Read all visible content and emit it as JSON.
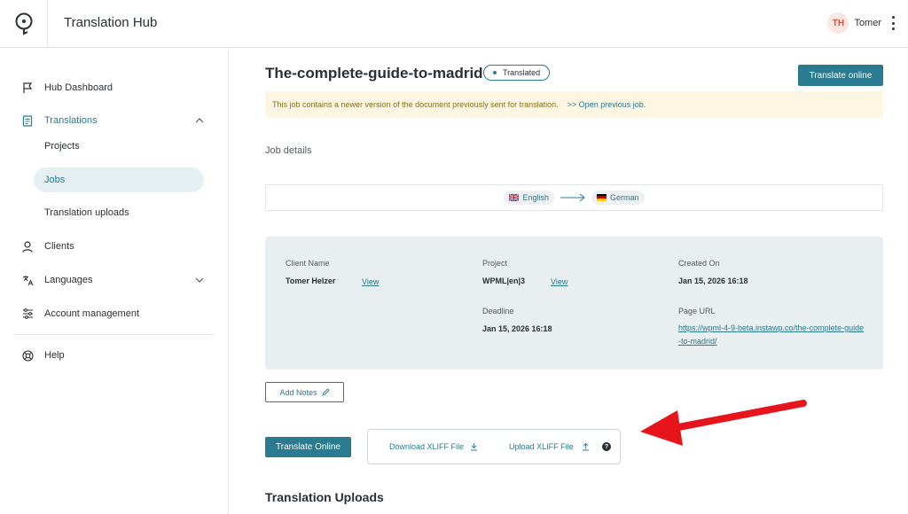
{
  "header": {
    "app_title": "Translation Hub",
    "user_initials": "TH",
    "user_name": "Tomer"
  },
  "sidebar": {
    "items": [
      {
        "label": "Hub Dashboard",
        "icon": "flag-icon"
      },
      {
        "label": "Translations",
        "icon": "document-icon"
      },
      {
        "label": "Projects"
      },
      {
        "label": "Jobs"
      },
      {
        "label": "Translation uploads"
      },
      {
        "label": "Clients",
        "icon": "person-icon"
      },
      {
        "label": "Languages",
        "icon": "translate-icon"
      },
      {
        "label": "Account management",
        "icon": "sliders-icon"
      },
      {
        "label": "Help",
        "icon": "lifebuoy-icon"
      }
    ]
  },
  "job": {
    "title": "The-complete-guide-to-madrid",
    "status": "Translated",
    "translate_online_top": "Translate online",
    "notice_text": "This job contains a newer version of the document previously sent for translation.",
    "notice_link": ">> Open previous job.",
    "section_label": "Job details",
    "source_lang": "English",
    "target_lang": "German",
    "details": {
      "client_label": "Client Name",
      "client_value": "Tomer Helzer",
      "client_link": "View",
      "project_label": "Project",
      "project_value": "WPML|en|3",
      "project_link": "View",
      "created_label": "Created On",
      "created_value": "Jan 15, 2026 16:18",
      "deadline_label": "Deadline",
      "deadline_value": "Jan 15, 2026 16:18",
      "url_label": "Page URL",
      "url_value": "https://wpml-4-9-beta.instawp.co/the-complete-guide-to-madrid/"
    },
    "add_notes": "Add Notes",
    "translate_online_bottom": "Translate Online",
    "download_xliff": "Download XLIFF File",
    "upload_xliff": "Upload XLIFF File",
    "help_glyph": "?",
    "uploads_title": "Translation Uploads"
  },
  "colors": {
    "accent": "#2a7a90",
    "notice_bg": "#fdf6e3",
    "details_bg": "#e9eef0",
    "annotation_arrow": "#e8141b"
  }
}
